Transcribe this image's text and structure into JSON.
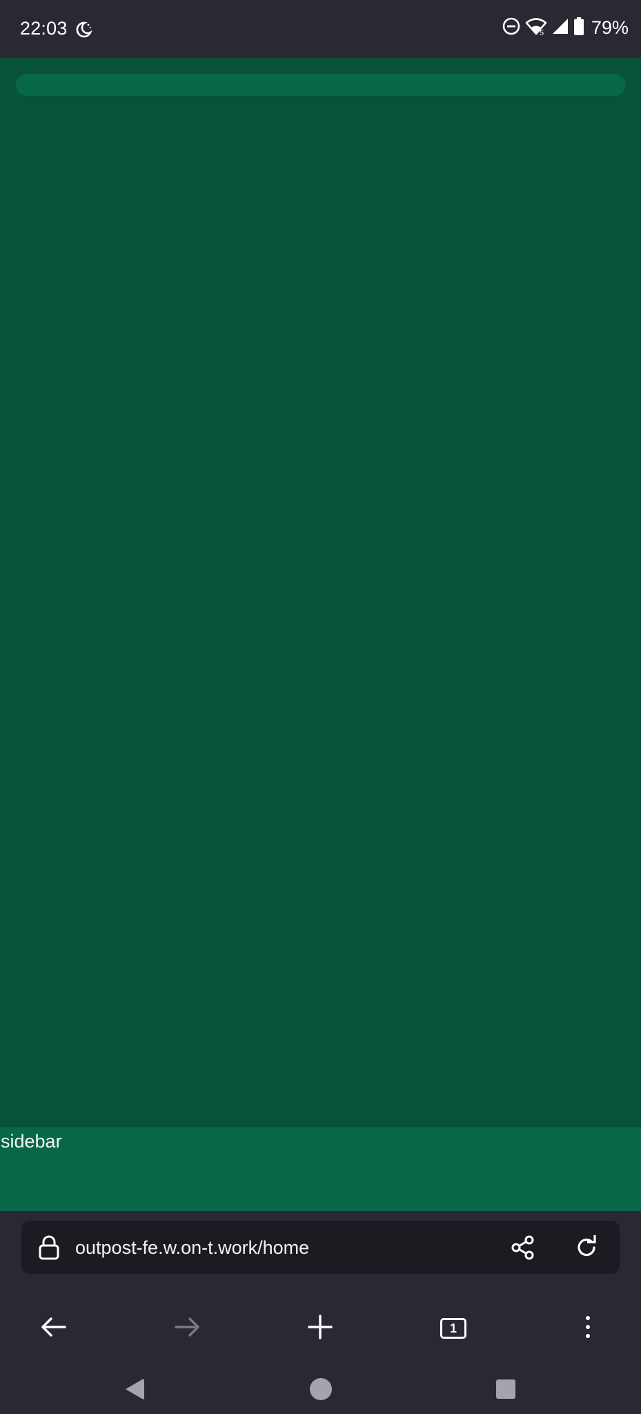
{
  "status_bar": {
    "time": "22:03",
    "battery_percent": "79%",
    "wifi_badge": "5",
    "icons": [
      "night-mode-icon",
      "do-not-disturb-icon",
      "wifi-icon",
      "signal-icon",
      "battery-icon"
    ]
  },
  "page": {
    "background_color": "#075239",
    "accent_color": "#076747",
    "sidebar_label": "sidebar"
  },
  "browser": {
    "url": "outpost-fe.w.on-t.work/home",
    "tab_count": "1",
    "icons": [
      "lock-icon",
      "share-icon",
      "reload-icon",
      "back-arrow-icon",
      "forward-arrow-icon",
      "new-tab-icon",
      "tab-switcher-icon",
      "overflow-menu-icon"
    ]
  },
  "system_nav": {
    "icons": [
      "nav-back-icon",
      "nav-home-icon",
      "nav-recents-icon"
    ]
  }
}
